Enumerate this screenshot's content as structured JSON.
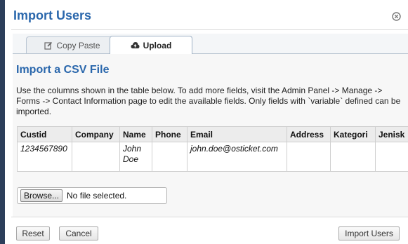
{
  "dialog": {
    "title": "Import Users",
    "close_icon": "close-circle-icon"
  },
  "tabs": [
    {
      "label": "Copy Paste",
      "icon": "edit-icon",
      "active": false
    },
    {
      "label": "Upload",
      "icon": "cloud-upload-icon",
      "active": true
    }
  ],
  "upload": {
    "section_title": "Import a CSV File",
    "instructions": "Use the columns shown in the table below. To add more fields, visit the Admin Panel -> Manage -> Forms -> Contact Information page to edit the available fields. Only fields with `variable` defined can be imported.",
    "table": {
      "headers": [
        "Custid",
        "Company",
        "Name",
        "Phone",
        "Email",
        "Address",
        "Kategori",
        "Jenisk"
      ],
      "row": [
        "1234567890",
        "",
        "John Doe",
        "",
        "john.doe@osticket.com",
        "",
        "",
        ""
      ]
    },
    "file_input": {
      "button_label": "Browse...",
      "status": "No file selected."
    }
  },
  "footer": {
    "reset_label": "Reset",
    "cancel_label": "Cancel",
    "import_label": "Import Users"
  },
  "colors": {
    "title": "#2a67ac",
    "tab_border": "#b9c5d2",
    "left_edge": "#2c3e5a"
  }
}
